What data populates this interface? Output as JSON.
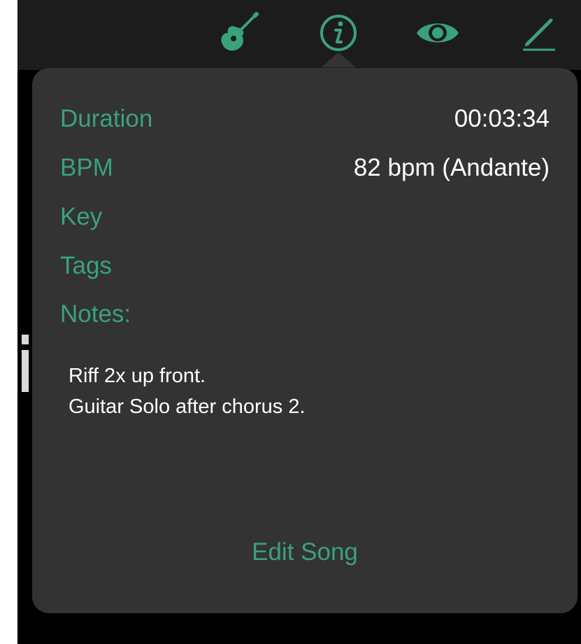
{
  "toolbar": {
    "icons": [
      "guitar-icon",
      "info-icon",
      "eye-icon",
      "pencil-icon"
    ],
    "accent": "#3aa27a"
  },
  "popover": {
    "rows": [
      {
        "label": "Duration",
        "value": "00:03:34"
      },
      {
        "label": "BPM",
        "value": "82 bpm (Andante)"
      },
      {
        "label": "Key",
        "value": ""
      },
      {
        "label": "Tags",
        "value": ""
      }
    ],
    "notes_label": "Notes:",
    "notes": [
      "Riff 2x up front.",
      "Guitar Solo after chorus 2."
    ],
    "edit_label": "Edit Song"
  },
  "colors": {
    "accent": "#3aa27a",
    "popover_bg": "#333333",
    "toolbar_bg": "#1c1c1c",
    "text": "#ffffff"
  }
}
